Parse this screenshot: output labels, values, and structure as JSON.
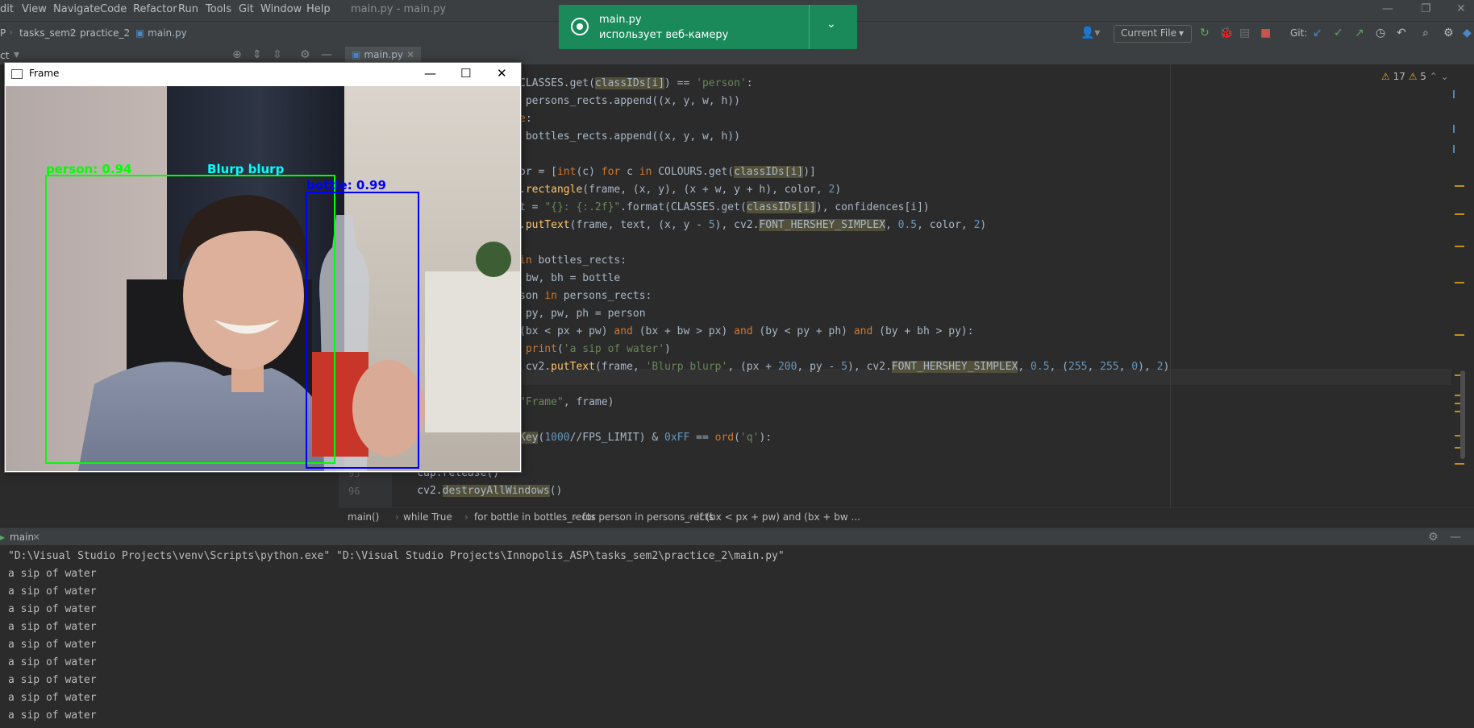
{
  "menu": [
    "dit",
    "View",
    "Navigate",
    "Code",
    "Refactor",
    "Run",
    "Tools",
    "Git",
    "Window",
    "Help"
  ],
  "window_title": "main.py - main.py",
  "breadcrumbs": [
    "P",
    "tasks_sem2",
    "practice_2",
    "main.py"
  ],
  "run_config": "Current File",
  "git_label": "Git:",
  "tool_window_label": "ct",
  "tab": "main.py",
  "notification": {
    "title": "main.py",
    "message": "использует веб-камеру"
  },
  "inspections": {
    "warnings": "17",
    "weak_warnings": "5"
  },
  "frame_window": {
    "title": "Frame",
    "labels": {
      "person": "person: 0.94",
      "blurp": "Blurp blurp",
      "bottle": "bottle: 0.99"
    }
  },
  "code_lines": [
    {
      "n": "",
      "segments": [
        [
          "CLASSES.get(",
          ""
        ],
        [
          "classIDs[i]",
          "hl"
        ],
        [
          ") == ",
          ""
        ],
        [
          "'person'",
          "str"
        ],
        [
          ":",
          ""
        ]
      ]
    },
    {
      "n": "",
      "segments": [
        [
          " persons_rects.append((x, y, w, h))",
          ""
        ]
      ]
    },
    {
      "n": "",
      "segments": [
        [
          "e",
          "kw"
        ],
        [
          ":",
          ""
        ]
      ]
    },
    {
      "n": "",
      "segments": [
        [
          " bottles_rects.append((x, y, w, h))",
          ""
        ]
      ]
    },
    {
      "n": "",
      "segments": [
        [
          "",
          ""
        ]
      ]
    },
    {
      "n": "",
      "segments": [
        [
          "or = [",
          ""
        ],
        [
          "int",
          "kw"
        ],
        [
          "(c) ",
          ""
        ],
        [
          "for",
          "kw"
        ],
        [
          " c ",
          ""
        ],
        [
          "in",
          "kw"
        ],
        [
          " COLOURS.get(",
          ""
        ],
        [
          "classIDs[i]",
          "hl"
        ],
        [
          ")]",
          ""
        ]
      ]
    },
    {
      "n": "",
      "segments": [
        [
          ".",
          ""
        ],
        [
          "rectangle",
          "fn"
        ],
        [
          "(frame, (x, y), (x + w, y + h), color, ",
          ""
        ],
        [
          "2",
          "num"
        ],
        [
          ")",
          ""
        ]
      ]
    },
    {
      "n": "",
      "segments": [
        [
          "t = ",
          ""
        ],
        [
          "\"{}: {:.2f}\"",
          "str"
        ],
        [
          ".format(CLASSES.get(",
          ""
        ],
        [
          "classIDs[i]",
          "hl"
        ],
        [
          "), confidences[i])",
          ""
        ]
      ]
    },
    {
      "n": "",
      "segments": [
        [
          ".",
          ""
        ],
        [
          "putText",
          "fn"
        ],
        [
          "(frame, text, (x, y - ",
          ""
        ],
        [
          "5",
          "num"
        ],
        [
          "), cv2.",
          ""
        ],
        [
          "FONT_HERSHEY_SIMPLEX",
          "hl"
        ],
        [
          ", ",
          ""
        ],
        [
          "0.5",
          "num"
        ],
        [
          ", color, ",
          ""
        ],
        [
          "2",
          "num"
        ],
        [
          ")",
          ""
        ]
      ]
    },
    {
      "n": "",
      "segments": [
        [
          "",
          ""
        ]
      ]
    },
    {
      "n": "",
      "segments": [
        [
          "in",
          "kw"
        ],
        [
          " bottles_rects:",
          ""
        ]
      ]
    },
    {
      "n": "",
      "segments": [
        [
          " bw, bh = bottle",
          ""
        ]
      ]
    },
    {
      "n": "",
      "segments": [
        [
          "son ",
          ""
        ],
        [
          "in",
          "kw"
        ],
        [
          " persons_rects:",
          ""
        ]
      ]
    },
    {
      "n": "",
      "segments": [
        [
          " py, pw, ph = person",
          ""
        ]
      ]
    },
    {
      "n": "",
      "segments": [
        [
          "(bx < px + pw) ",
          ""
        ],
        [
          "and",
          "kw"
        ],
        [
          " (bx + bw > px) ",
          ""
        ],
        [
          "and",
          "kw"
        ],
        [
          " (by < py + ph) ",
          ""
        ],
        [
          "and",
          "kw"
        ],
        [
          " (by + bh > py):",
          ""
        ]
      ]
    },
    {
      "n": "",
      "segments": [
        [
          " ",
          ""
        ],
        [
          "print",
          "kw"
        ],
        [
          "(",
          ""
        ],
        [
          "'a sip of water'",
          "str"
        ],
        [
          ")",
          ""
        ]
      ]
    },
    {
      "n": "",
      "segments": [
        [
          " cv2.",
          ""
        ],
        [
          "putText",
          "fn"
        ],
        [
          "(frame, ",
          ""
        ],
        [
          "'Blurp blurp'",
          "str"
        ],
        [
          ", (px + ",
          ""
        ],
        [
          "200",
          "num"
        ],
        [
          ", py - ",
          ""
        ],
        [
          "5",
          "num"
        ],
        [
          "), cv2.",
          ""
        ],
        [
          "FONT_HERSHEY_SIMPLEX",
          "hl"
        ],
        [
          ", ",
          ""
        ],
        [
          "0.5",
          "num"
        ],
        [
          ", (",
          ""
        ],
        [
          "255",
          "num"
        ],
        [
          ", ",
          ""
        ],
        [
          "255",
          "num"
        ],
        [
          ", ",
          ""
        ],
        [
          "0",
          "num"
        ],
        [
          "), ",
          ""
        ],
        [
          "2",
          "num"
        ],
        [
          ")",
          ""
        ]
      ]
    },
    {
      "n": "",
      "segments": [
        [
          "",
          ""
        ]
      ]
    },
    {
      "n": "",
      "segments": [
        [
          "\"Frame\"",
          "str"
        ],
        [
          ", frame)",
          ""
        ]
      ]
    },
    {
      "n": "",
      "segments": [
        [
          "",
          ""
        ]
      ]
    },
    {
      "n": "",
      "segments": [
        [
          "Key",
          "hl"
        ],
        [
          "(",
          ""
        ],
        [
          "1000",
          "num"
        ],
        [
          "//FPS_LIMIT) & ",
          ""
        ],
        [
          "0xFF",
          "num"
        ],
        [
          " == ",
          ""
        ],
        [
          "ord",
          "kw"
        ],
        [
          "(",
          ""
        ],
        [
          "'q'",
          "str"
        ],
        [
          "):",
          ""
        ]
      ]
    },
    {
      "n": "",
      "segments": [
        [
          "",
          ""
        ]
      ]
    },
    {
      "n": "95",
      "segments": [
        [
          "    cap.release()",
          ""
        ]
      ]
    },
    {
      "n": "96",
      "segments": [
        [
          "    cv2.",
          ""
        ],
        [
          "destroyAllWindows",
          "hl"
        ],
        [
          "()",
          ""
        ]
      ]
    }
  ],
  "editor_breadcrumb": [
    "main()",
    "while True",
    "for bottle in bottles_rects",
    "for person in persons_rects",
    "if (bx < px + pw) and (bx + bw ..."
  ],
  "run_panel": {
    "tab": "main",
    "command": "\"D:\\Visual Studio Projects\\venv\\Scripts\\python.exe\" \"D:\\Visual Studio Projects\\Innopolis_ASP\\tasks_sem2\\practice_2\\main.py\"",
    "output": [
      "a sip of water",
      "a sip of water",
      "a sip of water",
      "a sip of water",
      "a sip of water",
      "a sip of water",
      "a sip of water",
      "a sip of water",
      "a sip of water"
    ]
  },
  "colors": {
    "accent": "#4a88c7",
    "toast": "#1a8a5a",
    "person_box": "#00ff00",
    "bottle_box": "#0000ff",
    "blurp_text": "#00ffff"
  }
}
